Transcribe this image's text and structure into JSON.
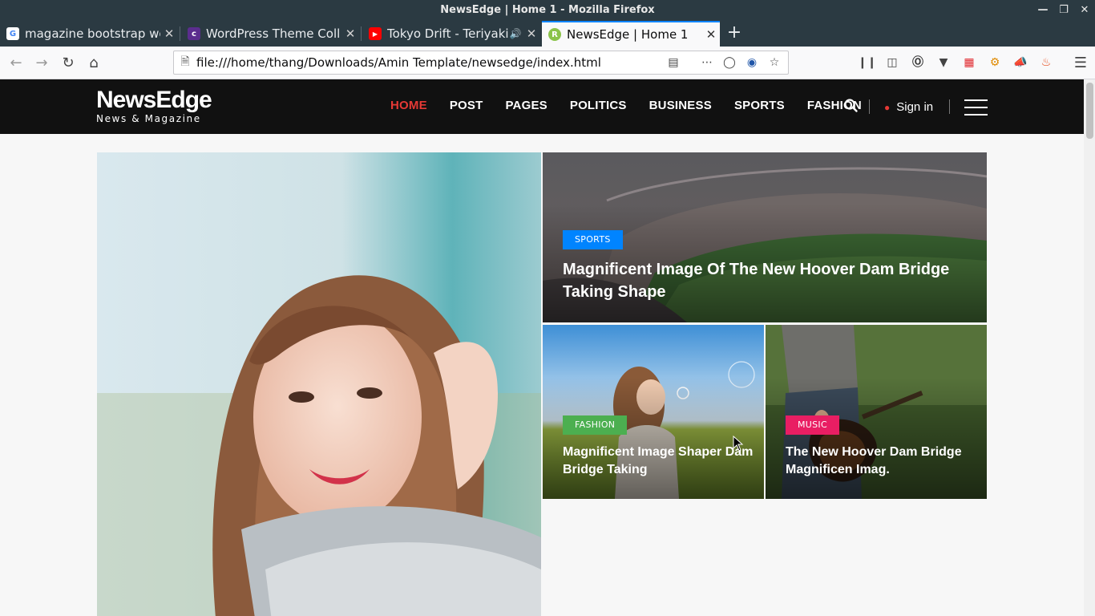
{
  "window": {
    "title": "NewsEdge | Home 1 - Mozilla Firefox",
    "controls": [
      "minimize",
      "maximize",
      "close"
    ]
  },
  "tabs": [
    {
      "title": "magazine bootstrap we",
      "icon": "google-icon",
      "icon_color": "#4285f4",
      "icon_letter": "G",
      "active": false
    },
    {
      "title": "WordPress Theme Coll",
      "icon": "colorlib-icon",
      "icon_color": "#5b2d8e",
      "icon_letter": "c",
      "active": false
    },
    {
      "title": "Tokyo Drift - Teriyaki",
      "icon": "youtube-icon",
      "icon_color": "#ff0000",
      "icon_letter": "▶",
      "active": false,
      "audio": true
    },
    {
      "title": "NewsEdge | Home 1",
      "icon": "newsedge-icon",
      "icon_color": "#8bc34a",
      "icon_letter": "R",
      "active": true
    }
  ],
  "urlbar": {
    "url": "file:///home/thang/Downloads/Amin Template/newsedge/index.html"
  },
  "site": {
    "logo_main": "NewsEdge",
    "logo_sub": "News & Magazine",
    "nav": [
      "HOME",
      "POST",
      "PAGES",
      "POLITICS",
      "BUSINESS",
      "SPORTS",
      "FASHION"
    ],
    "nav_active_index": 0,
    "signin": "Sign in",
    "accent": "#e53935"
  },
  "tiles": {
    "sports": {
      "category": "SPORTS",
      "category_color": "#0084ff",
      "title_line1": "Magnificent Image Of The New Hoover Dam Bridge",
      "title_line2": "Taking Shape"
    },
    "fashion": {
      "category": "FASHION",
      "category_color": "#4caf50",
      "title_line1": "Magnificent Image Shaper Dam",
      "title_line2": "Bridge Taking"
    },
    "music": {
      "category": "MUSIC",
      "category_color": "#e91e63",
      "title_line1": "The New Hoover Dam Bridge",
      "title_line2": "Magnificen Imag."
    }
  }
}
